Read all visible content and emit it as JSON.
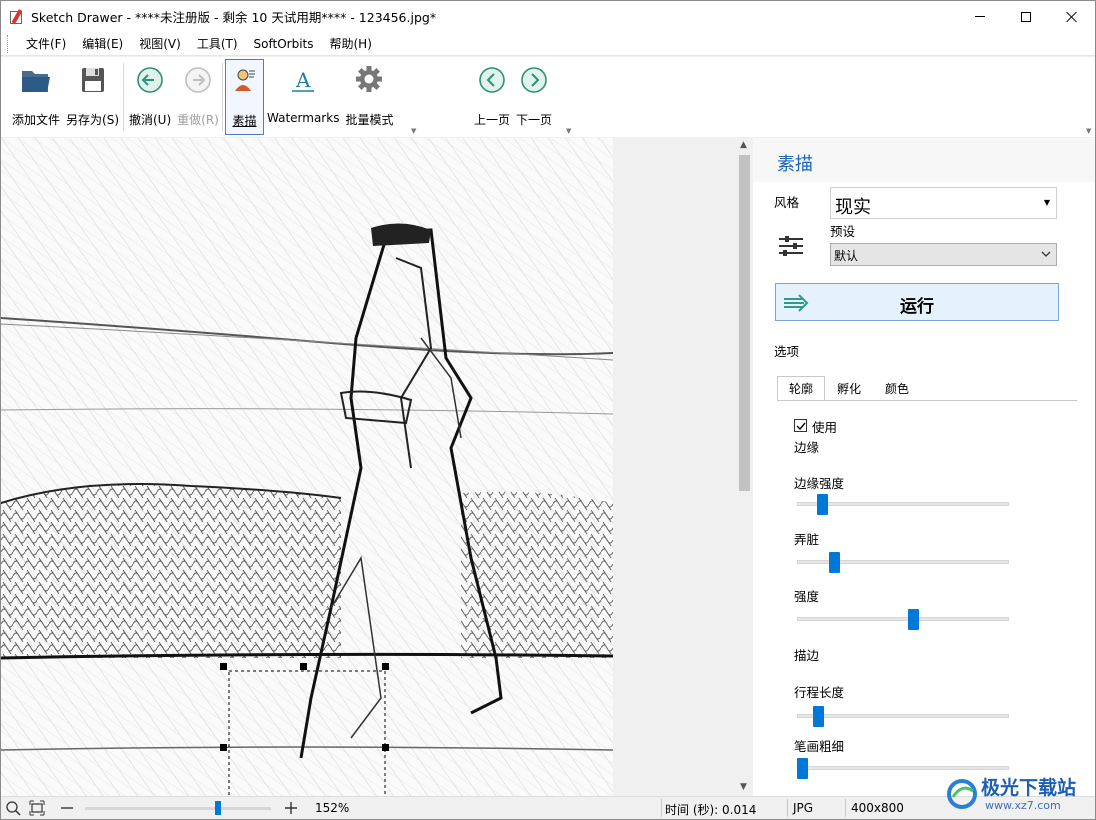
{
  "window": {
    "title": "Sketch Drawer - ****未注册版 - 剩余 10 天试用期**** - 123456.jpg*"
  },
  "menu": [
    "文件(F)",
    "编辑(E)",
    "视图(V)",
    "工具(T)",
    "SoftOrbits",
    "帮助(H)"
  ],
  "toolbar": {
    "add_file": "添加文件",
    "save_as": "另存为(S)",
    "undo": "撤消(U)",
    "redo": "重做(R)",
    "sketch": "素描",
    "watermarks": "Watermarks",
    "batch": "批量模式",
    "prev": "上一页",
    "next": "下一页"
  },
  "panel": {
    "title": "素描",
    "style_label": "风格",
    "style_value": "现实",
    "preset_label": "预设",
    "preset_value": "默认",
    "run_label": "运行",
    "options_label": "选项",
    "tabs": [
      "轮廓",
      "孵化",
      "颜色"
    ],
    "active_tab": "轮廓",
    "use_label": "使用",
    "use_checked": true,
    "section_edge": "边缘",
    "edge_strength_label": "边缘强度",
    "edge_strength_value": 0.1,
    "dirty_label": "弄脏",
    "dirty_value": 0.16,
    "intensity_label": "强度",
    "intensity_value": 0.55,
    "section_stroke": "描边",
    "stroke_length_label": "行程长度",
    "stroke_length_value": 0.08,
    "stroke_width_label": "笔画粗细",
    "stroke_width_value": 0.0
  },
  "status": {
    "zoom": "152%",
    "zoom_level": 0.72,
    "time": "时间 (秒): 0.014",
    "format": "JPG",
    "size": "400x800"
  },
  "watermark": {
    "name": "极光下载站",
    "url": "www.xz7.com"
  },
  "colors": {
    "accent": "#0078d7",
    "panel_title": "#1a66b8"
  }
}
